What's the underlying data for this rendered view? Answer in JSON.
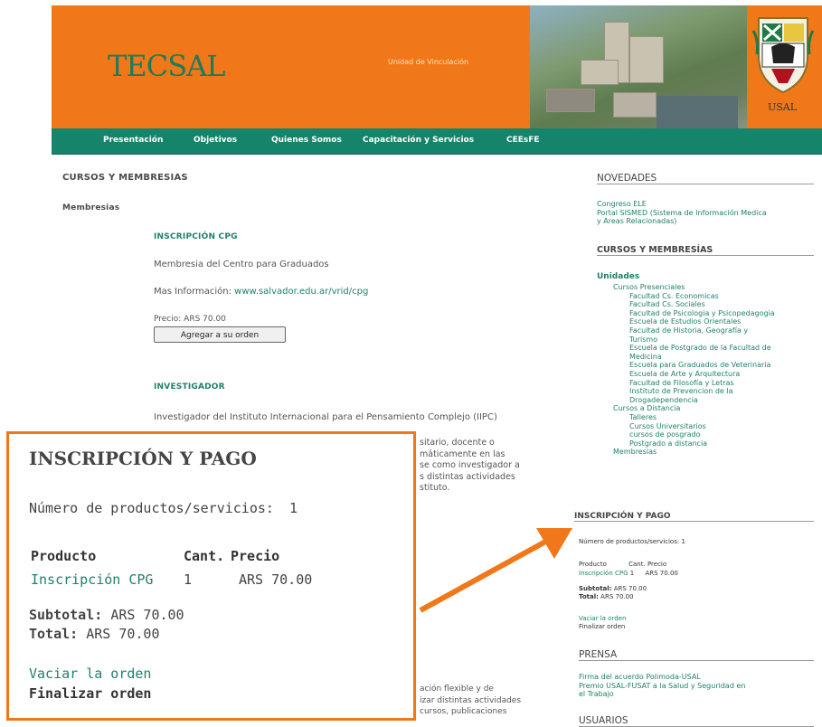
{
  "header": {
    "logo": "TECSAL",
    "unit_text": "Unidad de Vinculación",
    "university": "USAL"
  },
  "nav": [
    "Presentación",
    "Objetivos",
    "Quienes Somos",
    "Capacitación y Servicios",
    "CEEsFE"
  ],
  "main": {
    "section_title": "CURSOS Y MEMBRESIAS",
    "membresias_label": "Membresias",
    "item1": {
      "title": "INSCRIPCIÓN CPG",
      "desc": "Membresia del Centro para Graduados",
      "more_label": "Mas Información:",
      "more_link": "www.salvador.edu.ar/vrid/cpg",
      "price": "Precio: ARS 70.00",
      "button": "Agregar a su orden"
    },
    "item2": {
      "title": "INVESTIGADOR",
      "desc": "Investigador del Instituto Internacional para el Pensamiento Complejo (IIPC)",
      "frag1": [
        "sitario, docente o",
        "máticamente en las",
        "se como investigador a",
        "s distintas actividades",
        "stituto."
      ],
      "frag2": [
        "ación flexible y de",
        "izar distintas actividades",
        "cursos, publicaciones"
      ]
    }
  },
  "sidebar": {
    "novedades_title": "NOVEDADES",
    "novedades": [
      "Congreso ELE",
      "Portal SISMED (Sistema de Información Medica",
      "y Areas Relacionadas)"
    ],
    "cursos_title": "CURSOS Y MEMBRESÍAS",
    "unidades": "Unidades",
    "tree": [
      {
        "t": "Cursos Presenciales",
        "lvl": 1
      },
      {
        "t": "Facultad Cs. Economicas",
        "lvl": 2
      },
      {
        "t": "Facultad Cs. Sociales",
        "lvl": 2
      },
      {
        "t": "Facultad de Psicologia y Psicopedagogia",
        "lvl": 2
      },
      {
        "t": "Escuela de Estudios Orientales",
        "lvl": 2
      },
      {
        "t": "Facultad de Historia, Geografía y",
        "lvl": 2
      },
      {
        "t": "Turismo",
        "lvl": 2
      },
      {
        "t": "Escuela de Postgrado de la Facultad de",
        "lvl": 2
      },
      {
        "t": "Medicina",
        "lvl": 2
      },
      {
        "t": "Escuela para Graduados de Veterinaria",
        "lvl": 2
      },
      {
        "t": "Escuela de Arte y Arquitectura",
        "lvl": 2
      },
      {
        "t": "Facultad de Filosofía y Letras",
        "lvl": 2
      },
      {
        "t": "Instituto de Prevencion de la",
        "lvl": 2
      },
      {
        "t": "Drogadependencia",
        "lvl": 2
      },
      {
        "t": "Cursos a Distancia",
        "lvl": 1
      },
      {
        "t": "Talleres",
        "lvl": 2
      },
      {
        "t": "Cursos Universitarios",
        "lvl": 2
      },
      {
        "t": "cursos de posgrado",
        "lvl": 2
      },
      {
        "t": "Postgrado a distancia",
        "lvl": 2
      },
      {
        "t": "Membresias",
        "lvl": 1
      }
    ],
    "insc_title": "INSCRIPCIÓN Y PAGO",
    "num_label": "Número de productos/servicios:",
    "num": "1",
    "col_producto": "Producto",
    "col_cant": "Cant.",
    "col_precio": "Precio",
    "row_prod": "Inscripción CPG",
    "row_cant": "1",
    "row_precio": "ARS 70.00",
    "subtotal_label": "Subtotal:",
    "subtotal": "ARS 70.00",
    "total_label": "Total:",
    "total": "ARS 70.00",
    "vaciar": "Vaciar la orden",
    "finalizar": "Finalizar orden",
    "prensa_title": "PRENSA",
    "prensa": [
      "Firma del acuerdo Polimoda-USAL",
      "Premio USAL-FUSAT a la Salud y Seguridad en",
      "el Trabajo"
    ],
    "usuarios_title": "USUARIOS"
  },
  "zoom": {
    "title": "INSCRIPCIÓN Y PAGO",
    "num_label": "Número de productos/servicios:",
    "num": "1",
    "col_producto": "Producto",
    "col_cant": "Cant.",
    "col_precio": "Precio",
    "row_prod": "Inscripción CPG",
    "row_cant": "1",
    "row_precio": "ARS 70.00",
    "subtotal_label": "Subtotal:",
    "subtotal": "ARS 70.00",
    "total_label": "Total:",
    "total": "ARS 70.00",
    "vaciar": "Vaciar la orden",
    "finalizar": "Finalizar orden"
  },
  "colors": {
    "orange": "#f07818",
    "green": "#16846a",
    "link": "#20806a"
  }
}
